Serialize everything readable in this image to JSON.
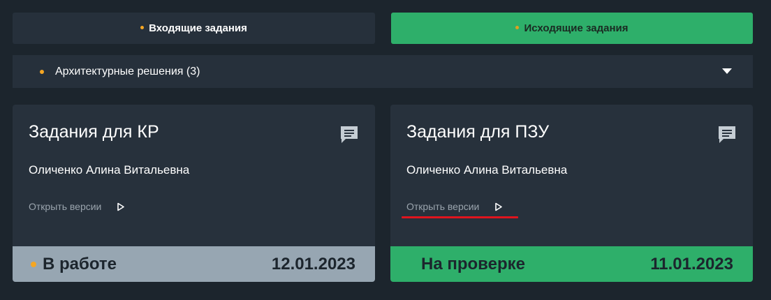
{
  "tabs": {
    "incoming": "Входящие задания",
    "outgoing": "Исходящие задания"
  },
  "category": {
    "label": "Архитектурные решения (3)"
  },
  "cards": [
    {
      "title": "Задания для КР",
      "person": "Оличенко Алина Витальевна",
      "open_versions": "Открыть версии",
      "status": "В работе",
      "date": "12.01.2023",
      "status_color": "#97a6b2"
    },
    {
      "title": "Задания для ПЗУ",
      "person": "Оличенко Алина Витальевна",
      "open_versions": "Открыть версии",
      "status": "На проверке",
      "date": "11.01.2023",
      "status_color": "#2eaf6a"
    }
  ],
  "colors": {
    "background": "#1c252d",
    "panel": "#26303b",
    "accent_green": "#2eaf6a",
    "accent_orange": "#f5a623",
    "highlight_red": "#e0141e"
  },
  "icons": {
    "comment": "chat-bubble-icon",
    "open": "play-outline-icon",
    "expand": "caret-down-icon"
  }
}
